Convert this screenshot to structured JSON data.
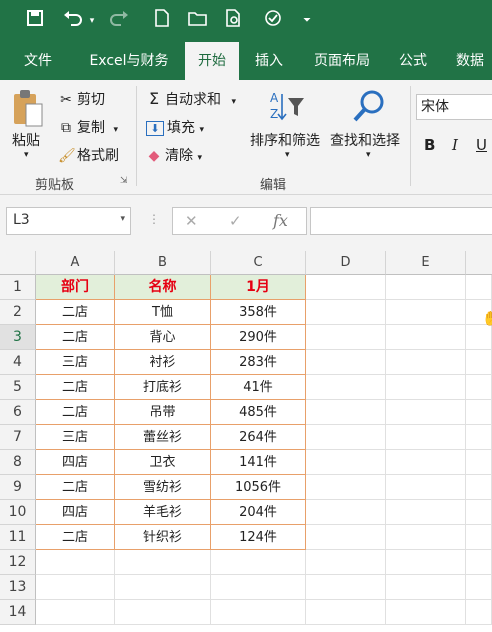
{
  "qat": {
    "icons": [
      "save-icon",
      "undo-icon",
      "redo-icon",
      "new-file-icon",
      "open-folder-icon",
      "print-preview-icon",
      "touch-mode-icon",
      "customize-qat-icon"
    ]
  },
  "tabs": [
    "文件",
    "Excel与财务",
    "开始",
    "插入",
    "页面布局",
    "公式",
    "数据"
  ],
  "ribbon": {
    "paste": "粘贴",
    "cut": "剪切",
    "copy": "复制",
    "format_painter": "格式刷",
    "clipboard_group": "剪贴板",
    "autosum": "自动求和",
    "fill": "填充",
    "clear": "清除",
    "sort_filter": "排序和筛选",
    "find_select": "查找和选择",
    "editing_group": "编辑",
    "font_name": "宋体",
    "bold": "B",
    "italic": "I",
    "underline": "U"
  },
  "formula_bar": {
    "name_box": "L3",
    "cancel": "✕",
    "enter": "✓",
    "fx": "fx",
    "formula": ""
  },
  "sheet": {
    "columns": [
      "A",
      "B",
      "C",
      "D",
      "E"
    ],
    "rows": [
      "1",
      "2",
      "3",
      "4",
      "5",
      "6",
      "7",
      "8",
      "9",
      "10",
      "11",
      "12",
      "13",
      "14"
    ],
    "header": [
      "部门",
      "名称",
      "1月"
    ],
    "data": [
      [
        "二店",
        "T恤",
        "358件"
      ],
      [
        "二店",
        "背心",
        "290件"
      ],
      [
        "三店",
        "衬衫",
        "283件"
      ],
      [
        "二店",
        "打底衫",
        "41件"
      ],
      [
        "二店",
        "吊带",
        "485件"
      ],
      [
        "三店",
        "蕾丝衫",
        "264件"
      ],
      [
        "四店",
        "卫衣",
        "141件"
      ],
      [
        "二店",
        "雪纺衫",
        "1056件"
      ],
      [
        "四店",
        "羊毛衫",
        "204件"
      ],
      [
        "二店",
        "针织衫",
        "124件"
      ]
    ],
    "header_color": "#e60012",
    "header_fill": "#e2efda",
    "border_color": "#e8a06a"
  },
  "colors": {
    "brand": "#217346"
  }
}
